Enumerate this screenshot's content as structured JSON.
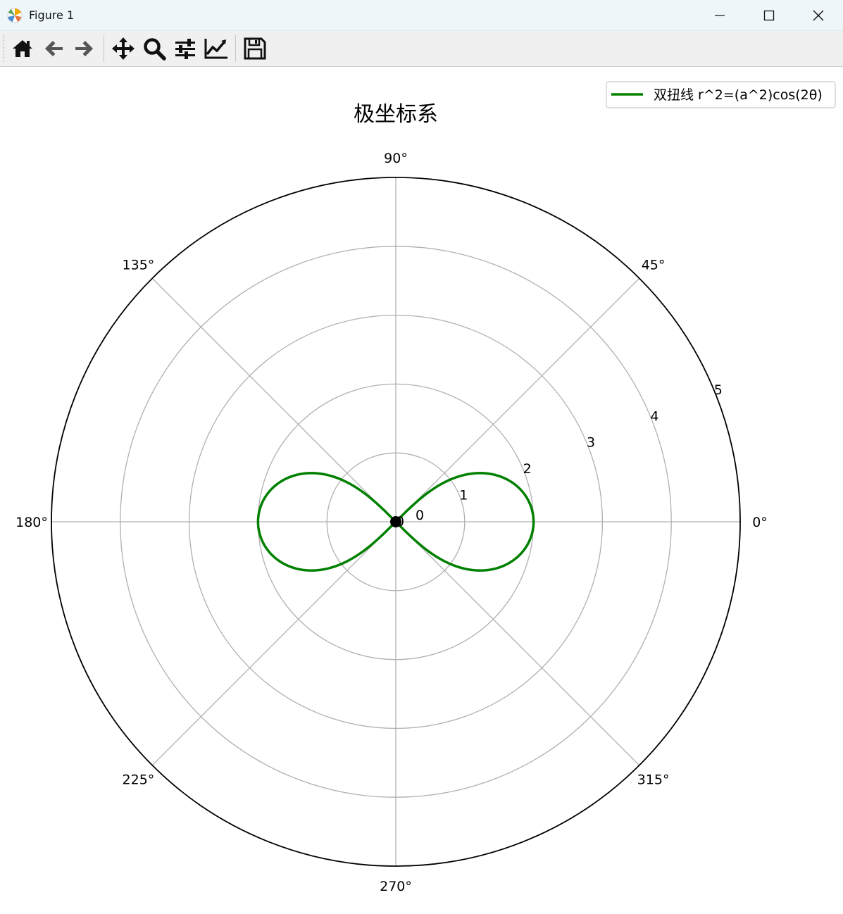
{
  "window": {
    "title": "Figure 1",
    "app_icon": "matplotlib-icon",
    "controls": [
      "minimize-icon",
      "maximize-icon",
      "close-icon"
    ]
  },
  "toolbar": {
    "buttons": [
      "home-icon",
      "back-arrow-icon",
      "forward-arrow-icon",
      "pan-icon",
      "zoom-icon",
      "configure-subplots-icon",
      "edit-axis-icon",
      "save-icon"
    ]
  },
  "chart_data": {
    "type": "line",
    "projection": "polar",
    "title": "极坐标系",
    "theta_ticks": [
      {
        "deg": 0,
        "label": "0°"
      },
      {
        "deg": 45,
        "label": "45°"
      },
      {
        "deg": 90,
        "label": "90°"
      },
      {
        "deg": 135,
        "label": "135°"
      },
      {
        "deg": 180,
        "label": "180°"
      },
      {
        "deg": 225,
        "label": "225°"
      },
      {
        "deg": 270,
        "label": "270°"
      },
      {
        "deg": 315,
        "label": "315°"
      }
    ],
    "r_ticks": [
      {
        "value": 0,
        "label": "0"
      },
      {
        "value": 1,
        "label": "1"
      },
      {
        "value": 2,
        "label": "2"
      },
      {
        "value": 3,
        "label": "3"
      },
      {
        "value": 4,
        "label": "4"
      },
      {
        "value": 5,
        "label": "5"
      }
    ],
    "rlim": [
      0,
      5
    ],
    "r_label_angle_deg": 22.5,
    "grid": true,
    "legend": {
      "placement": "top-right"
    },
    "series": [
      {
        "name": "双扭线 r^2=(a^2)cos(2θ)",
        "color": "#008000",
        "equation": "r^2=(a^2)cos(2θ)",
        "a": 2
      }
    ],
    "points": [
      {
        "theta_deg": 0,
        "r": 0,
        "label": "0",
        "color": "#000000"
      }
    ]
  }
}
